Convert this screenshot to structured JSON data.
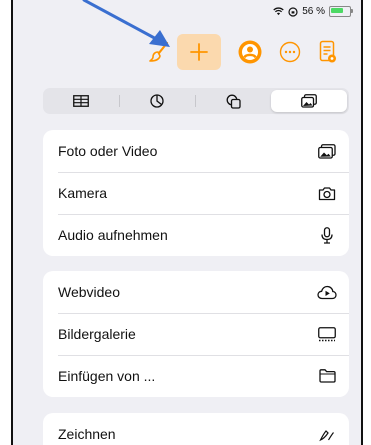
{
  "status_bar": {
    "battery_percent": "56 %"
  },
  "toolbar": {
    "icons": [
      "paintbrush-icon",
      "plus-icon",
      "collaboration-icon",
      "more-icon",
      "document-icon"
    ],
    "accent": "#ff9500",
    "selected_bg": "#fbd9ae"
  },
  "segments": {
    "tabs": [
      "table-icon",
      "chart-icon",
      "shapes-icon",
      "media-icon"
    ],
    "selected_index": 3
  },
  "menu": {
    "group1": [
      "Foto oder Video",
      "Kamera",
      "Audio aufnehmen"
    ],
    "group2": [
      "Webvideo",
      "Bildergalerie",
      "Einfügen von ..."
    ],
    "group3": [
      "Zeichnen"
    ]
  },
  "annotation": {
    "arrow_color": "#3a6fd0"
  }
}
